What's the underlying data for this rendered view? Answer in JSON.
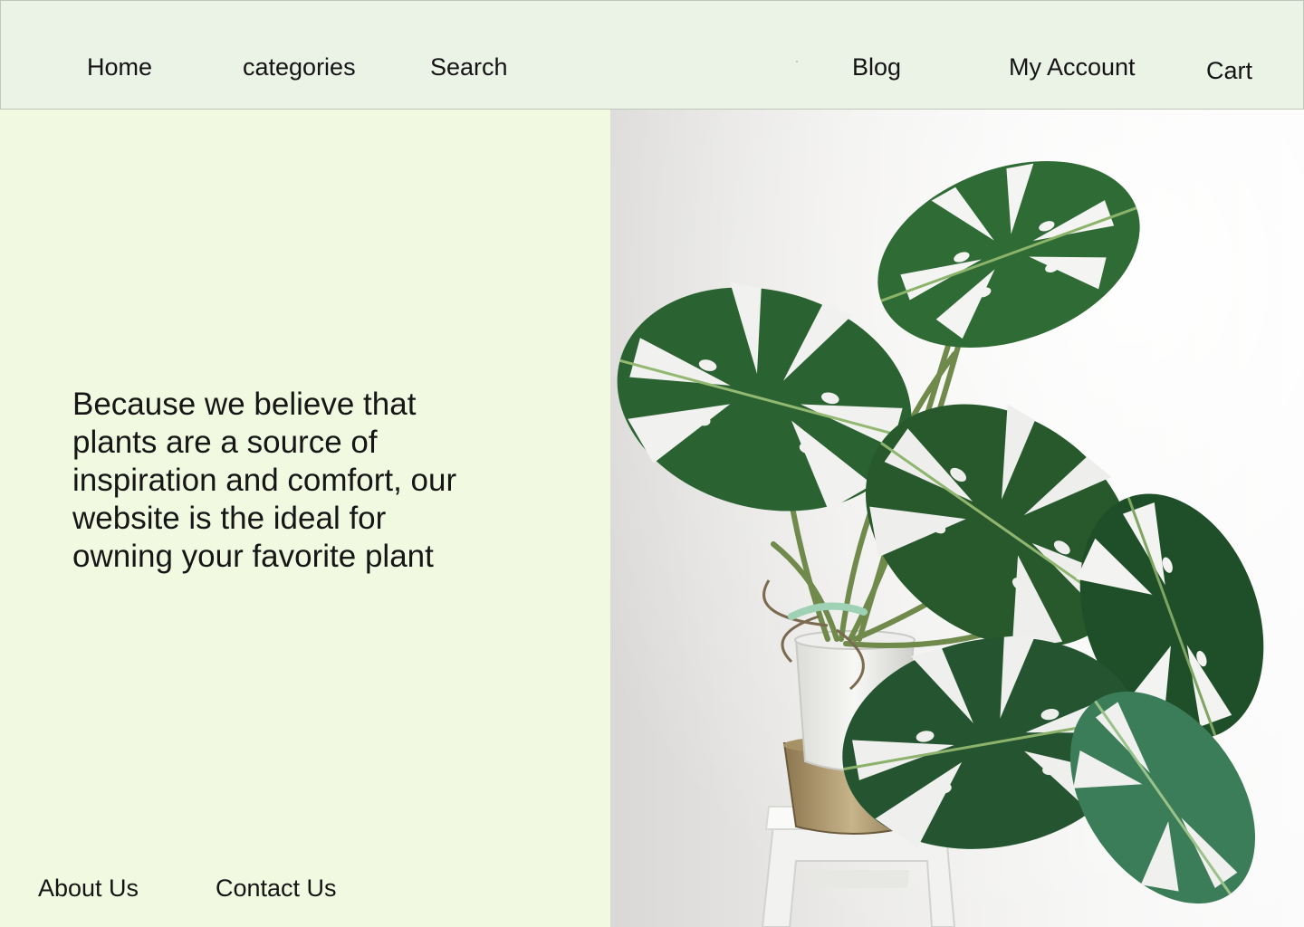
{
  "nav": {
    "home": "Home",
    "categories": "categories",
    "search": "Search",
    "blog": "Blog",
    "my_account": "My Account",
    "cart": "Cart"
  },
  "hero": {
    "tagline": "Because we believe that plants are a source of inspiration and comfort, our website is the ideal for owning your favorite plant",
    "image": "monstera-plant-photo"
  },
  "footer": {
    "about": "About Us",
    "contact": "Contact Us"
  },
  "colors": {
    "navbar_bg": "#ebf2e6",
    "page_bg": "#f1f9e1",
    "text": "#141414",
    "leaf_green": "#2f6b35"
  }
}
